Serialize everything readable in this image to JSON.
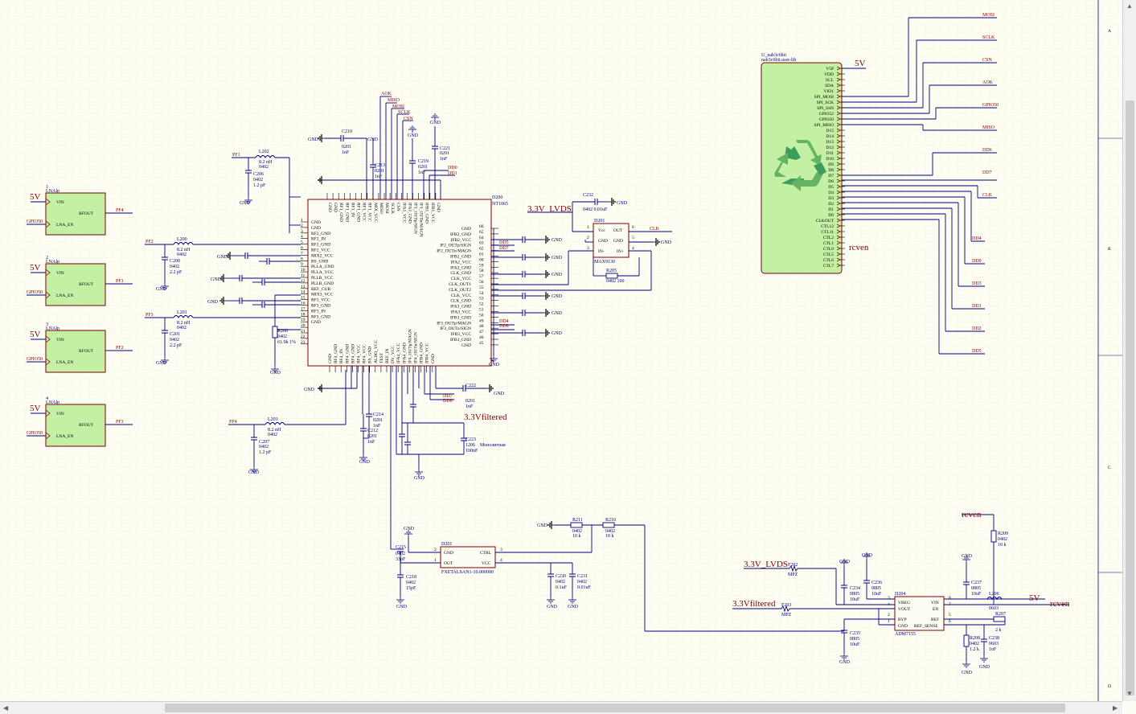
{
  "border_zones": [
    "A",
    "B",
    "C",
    "D"
  ],
  "lna_blocks": [
    {
      "num": "1",
      "name": "LNAlp",
      "pwr": "5V",
      "gpio": "GPIO50",
      "pins": [
        "VIN",
        "LNA_EN",
        "RFOUT"
      ],
      "out_net": "PF4"
    },
    {
      "num": "2",
      "name": "LNAlp",
      "pwr": "5V",
      "gpio": "GPIO50",
      "pins": [
        "VIN",
        "LNA_EN",
        "RFOUT"
      ],
      "out_net": "PF1"
    },
    {
      "num": "3",
      "name": "LNAlp",
      "pwr": "5V",
      "gpio": "GPIO50",
      "pins": [
        "VIN",
        "LNA_EN",
        "RFOUT"
      ],
      "out_net": "PF2"
    },
    {
      "num": "4",
      "name": "LNAlp",
      "pwr": "5V",
      "gpio": "GPIO50",
      "pins": [
        "VIN",
        "LNA_EN",
        "RFOUT"
      ],
      "out_net": "PF3"
    }
  ],
  "main_ic": {
    "ref": "D200",
    "part": "NT1065",
    "left_pins": [
      "GND",
      "GND",
      "RF2_GND",
      "RF2_IN",
      "RF2_GND",
      "RF2_VCC",
      "MIX2_VCC",
      "BS_GND",
      "PLLA_GND",
      "PLLA_VCC",
      "PLLB_VCC",
      "PLLB_GND",
      "REF_CUR",
      "MIX3_VCC",
      "RF3_VCC",
      "RF3_GND",
      "RF3_IN",
      "RF3_GND",
      "GND"
    ],
    "left_nums": [
      "1",
      "2",
      "3",
      "4",
      "5",
      "6",
      "7",
      "8",
      "9",
      "10",
      "11",
      "12",
      "13",
      "14",
      "15",
      "16",
      "17",
      "18",
      "19",
      "20",
      "21",
      "22",
      "23"
    ],
    "right_pins": [
      "GND",
      "IFB2_GND",
      "IFB2_VCC",
      "IF2_OUTp/SIGN",
      "IF2_OUTn/MAGN",
      "IFB2_GND",
      "IFA2_VCC",
      "IFA2_GND",
      "CLK_GND",
      "CLK_VCC",
      "CLK_OUT1",
      "CLK_OUT2",
      "CLK_VCC",
      "CLK_GND",
      "IFA3_GND",
      "IFA3_VCC",
      "IFB3_GND",
      "IF3_OUTp/MAGN",
      "IF3_OUTn/SIGN",
      "IFB3_VCC",
      "IFB3_GND",
      "GND"
    ],
    "right_nums": [
      "66",
      "65",
      "64",
      "63",
      "62",
      "61",
      "60",
      "59",
      "58",
      "57",
      "56",
      "55",
      "54",
      "53",
      "52",
      "51",
      "50",
      "49",
      "48",
      "47",
      "46",
      "45"
    ],
    "top_pins": [
      "GND",
      "GND",
      "RF1_GND",
      "RF1_GND",
      "RF1_IN",
      "RF1_GND",
      "RF1_VCC",
      "RF1_VCC",
      "MIX_VCC",
      "MISO",
      "MOSI",
      "SCLK",
      "CSN",
      "IFA1_VCC",
      "IFA1_GND",
      "IF1_OUTp/SIGN",
      "IF1_OUTn/MAGN",
      "IFB1_GND",
      "IFB1_VCC",
      "GND"
    ],
    "bottom_pins": [
      "GND",
      "RF4_GND",
      "RF4_IN",
      "RF4_GND",
      "RF4_GND",
      "RF4_VCC",
      "RF4_VCC",
      "BS_GND",
      "ALDO_VCC",
      "TEST",
      "REF_IN",
      "DV_VCC",
      "IFA4_VCC",
      "IFA4_GND",
      "IF4_OUTp/MAGN",
      "IF4_OUTn/SIGN",
      "IFB4_GND",
      "IFB4_VCC",
      "GND"
    ]
  },
  "rcv_module": {
    "ref": "U_nab3c6bii",
    "part": "nab3c6bii.user-lib",
    "pins": [
      "V5P",
      "VDD",
      "SCL",
      "SDA",
      "VIO1",
      "SPI_MOSI",
      "SPI_SCK",
      "SPI_SSN",
      "GPIO52",
      "GPIO50",
      "SPI_MISO",
      "D15",
      "D14",
      "D13",
      "D12",
      "D11",
      "D10",
      "D9",
      "D8",
      "D7",
      "D6",
      "D5",
      "D4",
      "D3",
      "D2",
      "D1",
      "D0",
      "CLKOUT",
      "CTL12",
      "CTL11",
      "CTL2",
      "CTL1",
      "CTL0",
      "CTL5",
      "CTL6",
      "CTL7"
    ],
    "pwr": "5V",
    "en_net": "rcven",
    "right_nets": [
      "MOSI",
      "SCLK",
      "CSN",
      "AOK",
      "GPIO50",
      "MISO",
      "DD6",
      "DD7",
      "CLK",
      "DD4",
      "DD0",
      "DD3",
      "DD1",
      "DD2",
      "DD5"
    ]
  },
  "buffer": {
    "ref": "D201",
    "part": "MAX9130",
    "pins": [
      "Vcc",
      "GND",
      "IN-",
      "OUT",
      "GND",
      "IN+"
    ],
    "nums": [
      "1",
      "2",
      "3",
      "6",
      "5",
      "4"
    ],
    "out_net": "CLK",
    "supply_net": "3.3V_LVDS",
    "cap": "C232",
    "cap_val": "0402 0.01uF",
    "res": "R205",
    "res_val": "0402 100"
  },
  "tcxo": {
    "ref": "D201",
    "part": "FXETALSAN1-10.000000",
    "pins": [
      "GND",
      "OUT",
      "CTRL",
      "VCC"
    ],
    "nums": [
      "2",
      "1",
      "3",
      "4"
    ]
  },
  "ldo": {
    "ref": "D204",
    "part": "ADM7155",
    "pins": [
      "VREG",
      "VOUT",
      "BYP",
      "GND",
      "VIN",
      "EN",
      "REF",
      "REF_SENSE"
    ],
    "nums": [
      "3",
      "4",
      "2",
      "1",
      "8",
      "7",
      "5",
      "6"
    ],
    "in_net": "5V",
    "en_net": "rcven"
  },
  "nets": {
    "lvds": "3.3V_LVDS",
    "filtered": "3.3Vfiltered",
    "gnd": "GND",
    "five_v": "5V",
    "rcven": "rcven",
    "aok": "AOK",
    "miso": "MISO",
    "mosi": "MOSI",
    "sclk": "SCLK",
    "csn": "CSN",
    "dd0": "DD0",
    "dd1": "DD1",
    "dd4": "DD4",
    "dd5": "DD5",
    "dd7": "DD7",
    "dd6": "DD6",
    "pf1": "PF1",
    "pf2": "PF2",
    "pf3": "PF3",
    "pf4": "PF4"
  },
  "passives": {
    "L202": "L202",
    "L202_val": "8.2 nH",
    "L202_pkg": "0402",
    "C206": "C206",
    "C206_pkg": "0402",
    "C206_val": "1.2 pF",
    "L200": "L200",
    "L200_val": "8.2 nH",
    "L200_pkg": "0402",
    "C200": "C200",
    "C200_pkg": "0402",
    "C200_val": "2.2 pF",
    "L201": "L201",
    "L201_val": "8.2 nH",
    "L201_pkg": "0402",
    "C201": "C201",
    "C201_pkg": "0402",
    "C201_val": "2.2 pF",
    "L203": "L203",
    "L203_val": "8.2 nH",
    "L203_pkg": "0402",
    "C207": "C207",
    "C207_pkg": "0402",
    "C207_val": "1.2 pF",
    "R200": "R200",
    "R200_pkg": "0402",
    "R200_val": "61.9k 1%",
    "C210": "C210",
    "C210_pkg": "0201",
    "C210_val": "1nF",
    "C213": "C213",
    "C213_pkg": "0201",
    "C213_val": "1nF",
    "C219": "C219",
    "C219_pkg": "0201",
    "C219_val": "1nF",
    "C221": "C221",
    "C221_pkg": "0201",
    "C221_val": "1nF",
    "C222": "C222",
    "C222_pkg": "0201",
    "C222_val": "1nF",
    "C214": "C214",
    "C214_pkg": "0201",
    "C214_val": "1nF",
    "C212": "C212",
    "C212_pkg": "0201",
    "C212_val": "1nF",
    "C223": "C223",
    "C223_pkg": "1206",
    "C223_val": "100nF",
    "C223_note": "Монолитная",
    "C215": "C215",
    "C215_pkg": "0402",
    "C215_val": "33pF",
    "C218": "C218",
    "C218_pkg": "0402",
    "C218_val": "15pF",
    "C230": "C230",
    "C230_pkg": "0402",
    "C230_val": "0.1uF",
    "C231": "C231",
    "C231_pkg": "0402",
    "C231_val": "0.01uF",
    "R211": "R211",
    "R211_pkg": "0402",
    "R211_val": "10 k",
    "R210": "R210",
    "R210_pkg": "0402",
    "R210_val": "10 k",
    "R209": "R209",
    "R209_pkg": "0402",
    "R209_val": "10 k",
    "F202": "F202",
    "F202_val": "MPZ",
    "F203": "F203",
    "F203_val": "MPZ",
    "C234": "C234",
    "C234_pkg": "0805",
    "C234_val": "10uF",
    "C236": "C236",
    "C236_pkg": "0805",
    "C236_val": "10uF",
    "C235": "C235",
    "C235_pkg": "0805",
    "C235_val": "10uF",
    "C237": "C237",
    "C237_pkg": "0805",
    "C237_val": "10uF",
    "L206": "L206",
    "L206_pkg": "0603",
    "R207": "R207",
    "R207_val": "2 k",
    "R208": "R208",
    "R208_pkg": "0402",
    "R208_val": "1.2 k",
    "C238": "C238",
    "C238_pkg": "0603",
    "C238_val": "1nF"
  }
}
